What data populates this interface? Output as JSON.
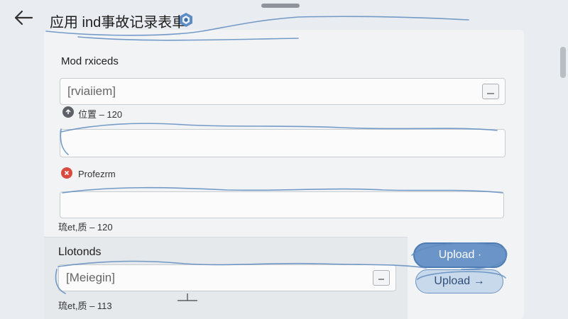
{
  "header": {
    "title": "应用 ind事故记录表車"
  },
  "form": {
    "section1_label": "Mod rxiceds",
    "field1_value": "[rviaiiem]",
    "info_text": "位置 – 120",
    "field2_value": "",
    "error_label": "Profezrm",
    "field3_value": "",
    "meta1": "琉et,质 – 120"
  },
  "lower": {
    "section_label": "Llotonds",
    "field_value": "[Meiegin]",
    "meta": "琉et,质 – 113"
  },
  "buttons": {
    "upload_primary": "Upload ·",
    "upload_secondary": "Upload →"
  },
  "colors": {
    "accent": "#6b95c9",
    "error": "#d94a3f",
    "scribble": "#5f8cc0"
  },
  "icons": {
    "back": "arrow-left-icon",
    "badge": "shield-badge-icon",
    "info": "arrow-up-circle-icon",
    "error": "x-circle-icon",
    "field1_action": "dropdown-box-icon",
    "field_lower_action": "minus-box-icon"
  }
}
